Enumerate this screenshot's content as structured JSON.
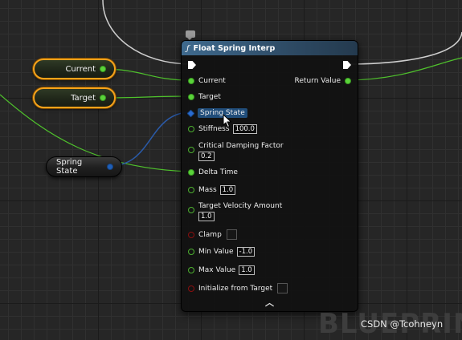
{
  "node": {
    "title": "Float Spring Interp",
    "title_icon": "function-icon",
    "header_color": "#3f6a8e",
    "inputs": {
      "current": "Current",
      "target": "Target",
      "spring_state": "Spring State",
      "stiffness_label": "Stiffness",
      "stiffness_value": "100.0",
      "damping_label": "Critical Damping Factor",
      "damping_value": "0.2",
      "delta_time": "Delta Time",
      "mass_label": "Mass",
      "mass_value": "1.0",
      "velocity_label": "Target Velocity Amount",
      "velocity_value": "1.0",
      "clamp_label": "Clamp",
      "min_label": "Min Value",
      "min_value": "-1.0",
      "max_label": "Max Value",
      "max_value": "1.0",
      "init_label": "Initialize from Target"
    },
    "outputs": {
      "return_value": "Return Value"
    }
  },
  "variables": {
    "current": "Current",
    "target": "Target",
    "spring_state": "Spring State"
  },
  "colors": {
    "float_pin": "#5ad33a",
    "struct_pin": "#1f5fb8",
    "bool_pin": "#8a0f0f",
    "selection": "#f6a21b",
    "exec_wire": "#c8c8c8"
  },
  "watermark": {
    "blueprint": "BLUEPRIN",
    "csdn": "CSDN @Tcohneyn"
  }
}
